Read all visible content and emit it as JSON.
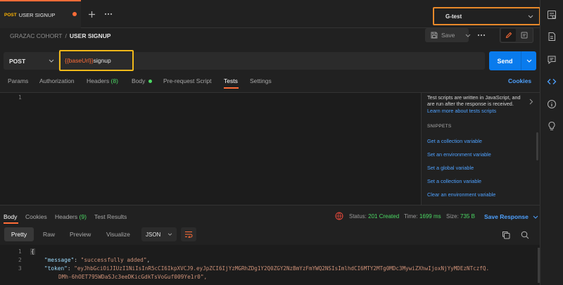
{
  "tab": {
    "method": "POST",
    "title": "USER SIGNUP"
  },
  "environment": {
    "name": "G-test"
  },
  "breadcrumb": {
    "collection": "GRAZAC COHORT",
    "separator": "/",
    "request": "USER SIGNUP"
  },
  "toolbar": {
    "save_label": "Save"
  },
  "request": {
    "method": "POST",
    "url_variable": "{{baseUrl}}",
    "url_path": "signup",
    "send_label": "Send"
  },
  "request_tabs": {
    "params": "Params",
    "authorization": "Authorization",
    "headers": "Headers",
    "headers_count": "(8)",
    "body": "Body",
    "pre_request": "Pre-request Script",
    "tests": "Tests",
    "settings": "Settings",
    "cookies": "Cookies"
  },
  "editor": {
    "line1": "1"
  },
  "side_panel": {
    "description": "Test scripts are written in JavaScript, and are run after the response is received.",
    "learn_more": "Learn more about tests scripts",
    "snippets_heading": "SNIPPETS",
    "snippets": [
      "Get a collection variable",
      "Set an environment variable",
      "Set a global variable",
      "Set a collection variable",
      "Clear an environment variable"
    ]
  },
  "response_tabs": {
    "body": "Body",
    "cookies": "Cookies",
    "headers": "Headers",
    "headers_count": "(9)",
    "test_results": "Test Results"
  },
  "response_status": {
    "status_label": "Status:",
    "status_value": "201 Created",
    "time_label": "Time:",
    "time_value": "1699 ms",
    "size_label": "Size:",
    "size_value": "735 B",
    "save_response": "Save Response"
  },
  "format": {
    "pretty": "Pretty",
    "raw": "Raw",
    "preview": "Preview",
    "visualize": "Visualize",
    "type": "JSON"
  },
  "response_body": {
    "lines": [
      "1",
      "2",
      "3"
    ],
    "open_brace": "{",
    "message_key": "\"message\"",
    "message_value": "\"successfully added\"",
    "token_key": "\"token\"",
    "token_value_1": "\"eyJhbGciOiJIUzI1NiIsInR5cCI6IkpXVCJ9.eyJpZCI6IjYzMGRhZDg1Y2Q0ZGY2NzBmYzFmYWQ2NSIsImlhdCI6MTY2MTg0MDc3MywiZXhwIjoxNjYyMDEzNTczfQ.",
    "token_value_2": "DMh-6hOET795WDaSJc3eeDKicGdkTsVoGuf009Ye1r0\","
  },
  "colors": {
    "accent": "#ff6c37",
    "send_blue": "#097bed",
    "link_blue": "#4ea1ff",
    "status_green": "#4cd964",
    "highlight_yellow": "#f0b81a",
    "env_highlight": "#e8892a"
  }
}
